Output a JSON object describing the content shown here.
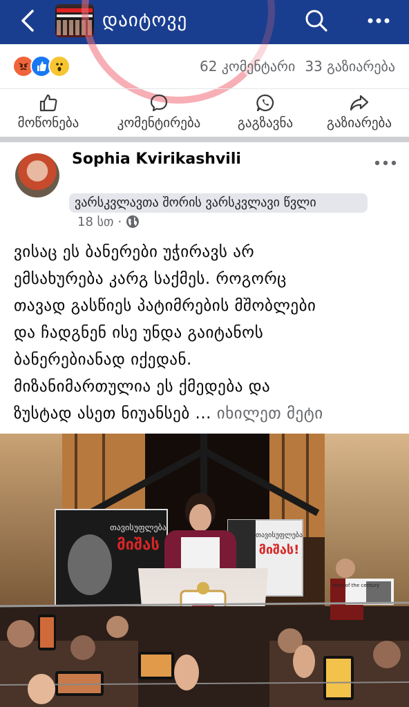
{
  "header": {
    "title": "დაიტოვე",
    "back_icon": "back-arrow-icon",
    "search_icon": "search-icon",
    "more_icon": "more-dots-icon"
  },
  "reactions": {
    "types": [
      "angry",
      "like",
      "wow"
    ],
    "comments": "62 კომენტარი",
    "shares": "33 გაზიარება"
  },
  "actions": [
    {
      "label": "მოწონება",
      "icon": "thumbs-up-icon"
    },
    {
      "label": "კომენტირება",
      "icon": "comment-icon"
    },
    {
      "label": "გაგზავნა",
      "icon": "whatsapp-icon"
    },
    {
      "label": "გაზიარება",
      "icon": "share-icon"
    }
  ],
  "post": {
    "author": "Sophia Kvirikashvili",
    "group": "ვარსკვლავთა შორის ვარსკვლავი წვლი",
    "time": "18 სთ",
    "separator": "·",
    "lines": [
      "ვისაც ეს ბანერები უჭირავს არ",
      "ემსახურება კარგ საქმეს. როგორც",
      "თავად გასწიეს პატიმრების მშობლები",
      "და ჩადგნენ ისე უნდა გაიტანოს",
      "ბანერებიანად იქედან.",
      "მიზანიმართულია ეს ქმედება და"
    ],
    "last_line": "ზუსტად ასეთ ნიუანსებ ...",
    "see_more": "იხილეთ მეტი"
  },
  "photo": {
    "banner_left_title": "თავისუფლება",
    "banner_left_name": "მიშას",
    "banner_right_title": "თავისუფლება",
    "banner_right_name": "მიშას!",
    "sign_text": "Hero of the century"
  },
  "colors": {
    "header_bg": "#1a3e8f",
    "like": "#1877f2",
    "angry": "#f0643c",
    "wow": "#f7c531"
  }
}
